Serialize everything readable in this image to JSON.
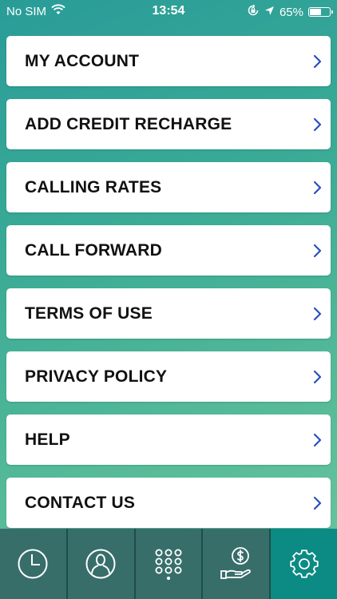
{
  "status_bar": {
    "carrier": "No SIM",
    "time": "13:54",
    "battery_percent": "65%",
    "battery_level": 0.65
  },
  "menu": {
    "items": [
      {
        "label": "MY ACCOUNT"
      },
      {
        "label": "ADD CREDIT RECHARGE"
      },
      {
        "label": "CALLING RATES"
      },
      {
        "label": "CALL FORWARD"
      },
      {
        "label": "TERMS OF USE"
      },
      {
        "label": "PRIVACY POLICY"
      },
      {
        "label": "HELP"
      },
      {
        "label": "CONTACT US"
      }
    ]
  },
  "tab_bar": {
    "tabs": [
      {
        "icon": "clock-icon",
        "active": false
      },
      {
        "icon": "contacts-icon",
        "active": false
      },
      {
        "icon": "dialpad-icon",
        "active": false
      },
      {
        "icon": "credit-icon",
        "active": false
      },
      {
        "icon": "gear-icon",
        "active": true
      }
    ]
  },
  "colors": {
    "accent_chevron": "#2b4fb8",
    "tab_active": "#0c8a84",
    "tab_inactive": "#376e6a"
  }
}
